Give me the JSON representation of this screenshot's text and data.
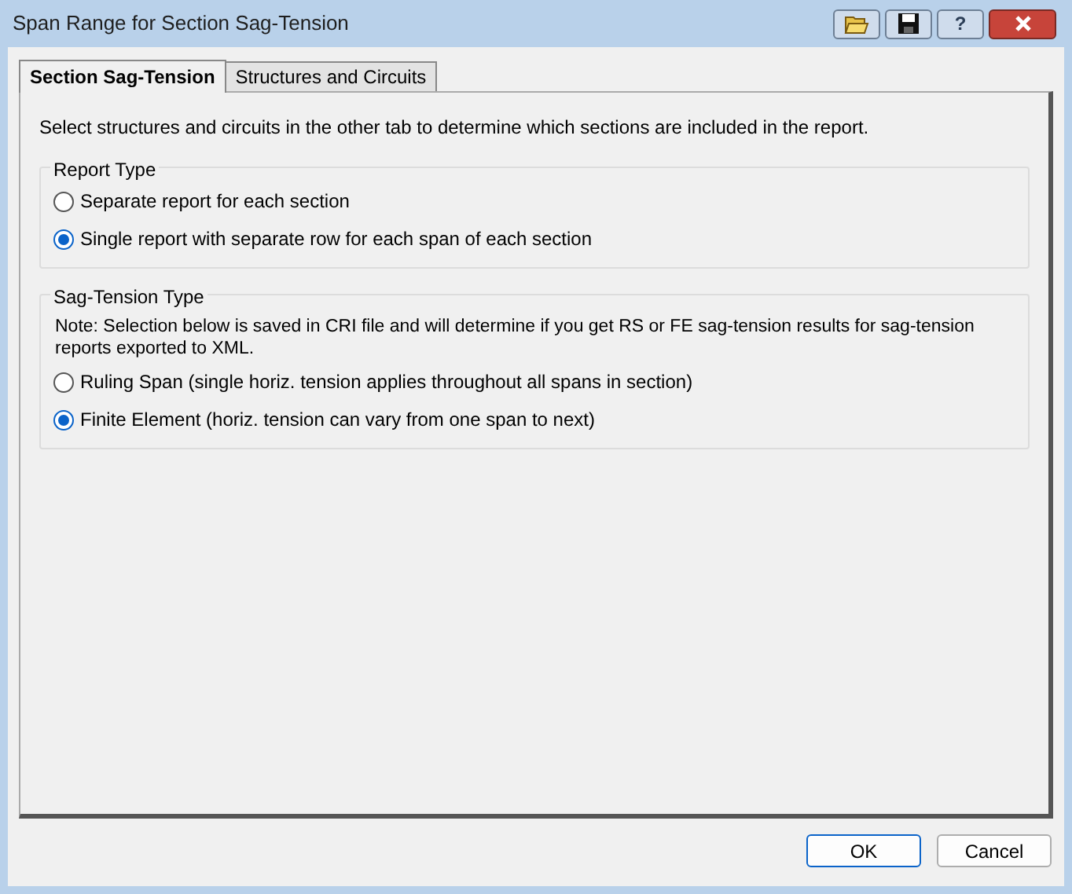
{
  "window": {
    "title": "Span Range for Section Sag-Tension"
  },
  "title_buttons": [
    {
      "kind": "open"
    },
    {
      "kind": "save"
    },
    {
      "kind": "help",
      "label": "?"
    },
    {
      "kind": "close"
    }
  ],
  "tabs": [
    {
      "label": "Section Sag-Tension",
      "selected": true
    },
    {
      "label": "Structures and Circuits",
      "selected": false
    }
  ],
  "intro": "Select structures and circuits in the other tab to determine which sections are included in the report.",
  "groups": [
    {
      "title": "Report Type",
      "options": [
        {
          "label": "Separate report for each section",
          "selected": false
        },
        {
          "label": "Single report with separate row for each span of each section",
          "selected": true
        }
      ]
    },
    {
      "title": "Sag-Tension Type",
      "note": "Note: Selection below is saved in CRI file and will determine if you get RS or FE sag-tension results for sag-tension reports exported to XML.",
      "options": [
        {
          "label": "Ruling Span (single horiz. tension applies throughout all spans in section)",
          "selected": false
        },
        {
          "label": "Finite Element (horiz. tension can vary from one span to next)",
          "selected": true
        }
      ]
    }
  ],
  "buttons": [
    {
      "label": "OK",
      "default": true
    },
    {
      "label": "Cancel",
      "default": false
    }
  ]
}
